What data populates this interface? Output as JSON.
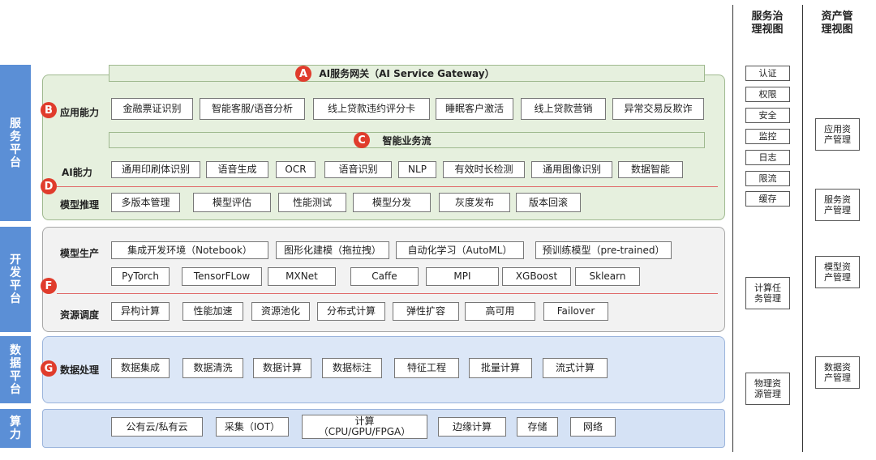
{
  "platforms": {
    "service": "服务平台",
    "dev": "开发平台",
    "data": "数据平台",
    "compute": "算力"
  },
  "markers": {
    "a": "A",
    "b": "B",
    "c": "C",
    "d": "D",
    "f": "F",
    "g": "G"
  },
  "gateway": "AI服务网关（AI Service Gateway）",
  "workflow": "智能业务流",
  "rows": {
    "app": {
      "label": "应用能力",
      "items": [
        "金融票证识别",
        "智能客服/语音分析",
        "线上贷款违约评分卡",
        "睡眠客户激活",
        "线上贷款营销",
        "异常交易反欺诈"
      ]
    },
    "ai": {
      "label": "AI能力",
      "items": [
        "通用印刷体识别",
        "语音生成",
        "OCR",
        "语音识别",
        "NLP",
        "有效时长检测",
        "通用图像识别",
        "数据智能"
      ]
    },
    "infer": {
      "label": "模型推理",
      "items": [
        "多版本管理",
        "模型评估",
        "性能测试",
        "模型分发",
        "灰度发布",
        "版本回滚"
      ]
    },
    "prod": {
      "label": "模型生产",
      "items": [
        "集成开发环境（Notebook）",
        "图形化建模（拖拉拽）",
        "自动化学习（AutoML）",
        "预训练模型（pre-trained）"
      ]
    },
    "frameworks": {
      "items": [
        "PyTorch",
        "TensorFLow",
        "MXNet",
        "Caffe",
        "MPI",
        "XGBoost",
        "Sklearn"
      ]
    },
    "sched": {
      "label": "资源调度",
      "items": [
        "异构计算",
        "性能加速",
        "资源池化",
        "分布式计算",
        "弹性扩容",
        "高可用",
        "Failover"
      ]
    },
    "dataproc": {
      "label": "数据处理",
      "items": [
        "数据集成",
        "数据清洗",
        "数据计算",
        "数据标注",
        "特征工程",
        "批量计算",
        "流式计算"
      ]
    },
    "compute": {
      "items": [
        "公有云/私有云",
        "采集（IOT）",
        "计算\n（CPU/GPU/FPGA）",
        "边缘计算",
        "存储",
        "网络"
      ]
    }
  },
  "governance": {
    "title": "服务治理视图",
    "items": [
      "认证",
      "权限",
      "安全",
      "监控",
      "日志",
      "限流",
      "缓存"
    ],
    "task": "计算任务管理",
    "physical": "物理资源管理"
  },
  "assets": {
    "title": "资产管理视图",
    "app": "应用资产管理",
    "service": "服务资产管理",
    "model": "模型资产管理",
    "data": "数据资产管理"
  }
}
